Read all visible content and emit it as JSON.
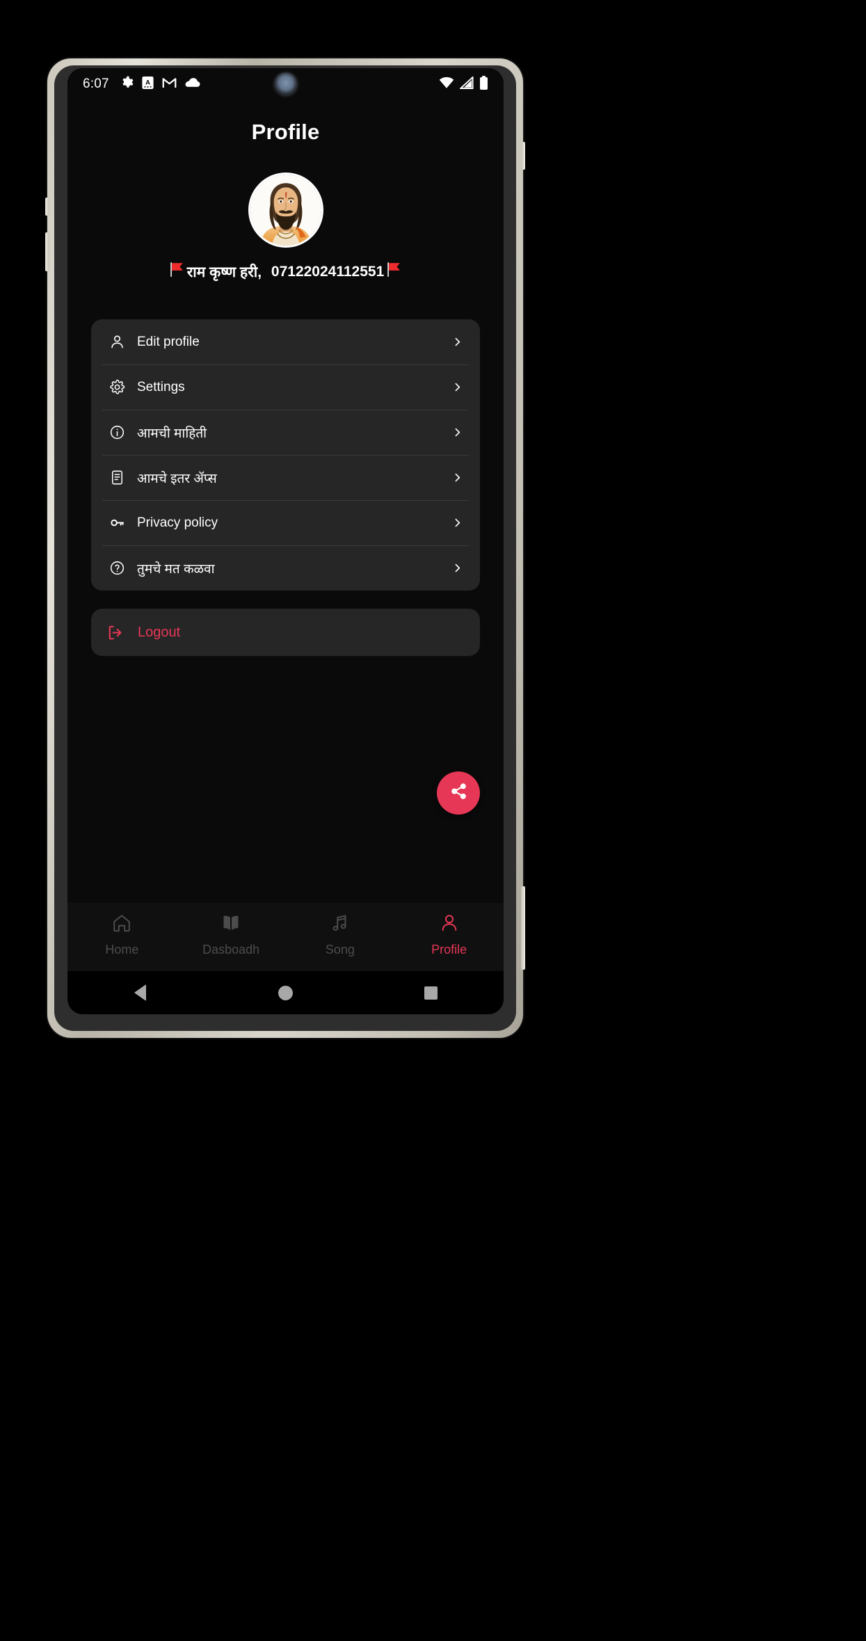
{
  "status_bar": {
    "time": "6:07",
    "left_icons": [
      "gear-icon",
      "a-badge-icon",
      "gmail-icon",
      "cloud-icon"
    ],
    "right_icons": [
      "wifi-icon",
      "cell-signal-icon",
      "battery-icon"
    ]
  },
  "header": {
    "title": "Profile"
  },
  "profile": {
    "avatar_alt": "saint-portrait-avatar",
    "flag_left": "🚩",
    "flag_right": "🚩",
    "name": "राम कृष्ण हरी,",
    "id": "07122024112551"
  },
  "menu": {
    "items": [
      {
        "icon": "person-icon",
        "label": "Edit profile",
        "chevron": "chevron-right-icon"
      },
      {
        "icon": "gear-icon",
        "label": "Settings",
        "chevron": "chevron-right-icon"
      },
      {
        "icon": "info-icon",
        "label": "आमची माहिती",
        "chevron": "chevron-right-icon"
      },
      {
        "icon": "document-icon",
        "label": "आमचे इतर ॲप्स",
        "chevron": "chevron-right-icon"
      },
      {
        "icon": "key-icon",
        "label": "Privacy policy",
        "chevron": "chevron-right-icon"
      },
      {
        "icon": "help-icon",
        "label": "तुमचे मत कळवा",
        "chevron": "chevron-right-icon"
      }
    ]
  },
  "logout": {
    "icon": "logout-icon",
    "label": "Logout",
    "color": "#e63756"
  },
  "fab": {
    "icon": "share-icon",
    "color": "#e63756"
  },
  "bottom_nav": {
    "items": [
      {
        "icon": "home-icon",
        "label": "Home",
        "active": false
      },
      {
        "icon": "book-icon",
        "label": "Dasboadh",
        "active": false
      },
      {
        "icon": "music-icon",
        "label": "Song",
        "active": false
      },
      {
        "icon": "person-icon",
        "label": "Profile",
        "active": true
      }
    ],
    "active_color": "#e63756",
    "inactive_color": "#4c4c4c"
  },
  "system_nav": {
    "back": "back-triangle-icon",
    "home": "home-circle-icon",
    "recents": "recents-square-icon"
  },
  "theme": {
    "screen_bg": "#0a0a0a",
    "card_bg": "#262626",
    "accent": "#e63756",
    "text": "#ffffff"
  }
}
